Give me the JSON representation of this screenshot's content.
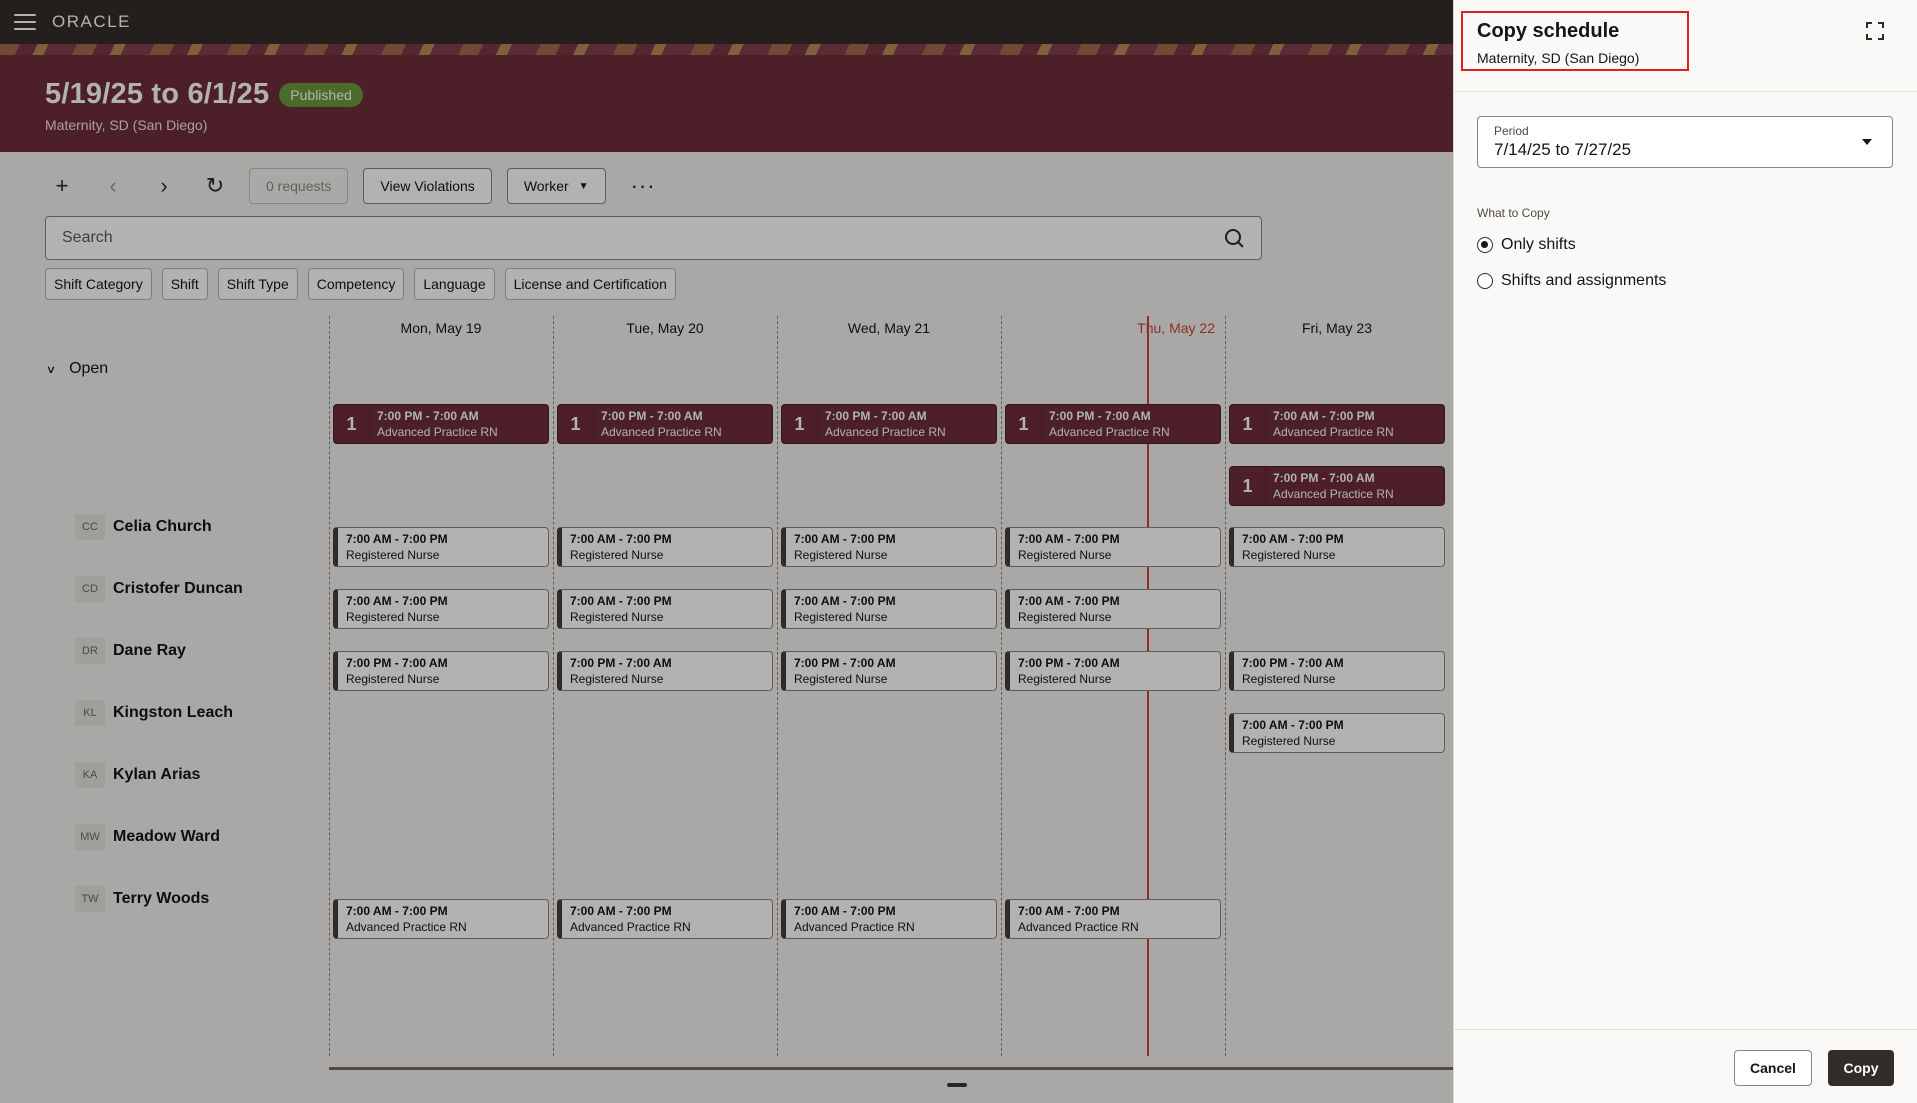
{
  "header": {
    "logo": "ORACLE"
  },
  "schedule": {
    "title": "5/19/25 to 6/1/25",
    "status": "Published",
    "unit": "Maternity, SD (San Diego)"
  },
  "toolbar": {
    "requests_label": "0 requests",
    "view_violations_label": "View Violations",
    "worker_label": "Worker"
  },
  "search": {
    "placeholder": "Search"
  },
  "filters": [
    "Shift Category",
    "Shift",
    "Shift Type",
    "Competency",
    "Language",
    "License and Certification"
  ],
  "days": [
    "Mon, May 19",
    "Tue, May 20",
    "Wed, May 21",
    "Thu, May 22",
    "Fri, May 23"
  ],
  "open_group": {
    "label": "Open"
  },
  "open_shifts": [
    {
      "count": "1",
      "time": "7:00 PM - 7:00 AM",
      "role": "Advanced Practice RN"
    },
    {
      "count": "1",
      "time": "7:00 PM - 7:00 AM",
      "role": "Advanced Practice RN"
    },
    {
      "count": "1",
      "time": "7:00 PM - 7:00 AM",
      "role": "Advanced Practice RN"
    },
    {
      "count": "1",
      "time": "7:00 PM - 7:00 AM",
      "role": "Advanced Practice RN"
    },
    {
      "count": "1",
      "time": "7:00 AM - 7:00 PM",
      "role": "Advanced Practice RN"
    },
    {
      "count": "1",
      "time": "7:00 PM - 7:00 AM",
      "role": "Advanced Practice RN"
    }
  ],
  "workers": [
    {
      "initials": "CC",
      "name": "Celia Church"
    },
    {
      "initials": "CD",
      "name": "Cristofer Duncan"
    },
    {
      "initials": "DR",
      "name": "Dane Ray"
    },
    {
      "initials": "KL",
      "name": "Kingston Leach"
    },
    {
      "initials": "KA",
      "name": "Kylan Arias"
    },
    {
      "initials": "MW",
      "name": "Meadow Ward"
    },
    {
      "initials": "TW",
      "name": "Terry Woods"
    }
  ],
  "shifts": [
    {
      "time": "7:00 AM - 7:00 PM",
      "role": "Registered Nurse"
    },
    {
      "time": "7:00 AM - 7:00 PM",
      "role": "Registered Nurse"
    },
    {
      "time": "7:00 AM - 7:00 PM",
      "role": "Registered Nurse"
    },
    {
      "time": "7:00 AM - 7:00 PM",
      "role": "Registered Nurse"
    },
    {
      "time": "7:00 AM - 7:00 PM",
      "role": "Registered Nurse"
    },
    {
      "time": "7:00 AM - 7:00 PM",
      "role": "Registered Nurse"
    },
    {
      "time": "7:00 AM - 7:00 PM",
      "role": "Registered Nurse"
    },
    {
      "time": "7:00 AM - 7:00 PM",
      "role": "Registered Nurse"
    },
    {
      "time": "7:00 AM - 7:00 PM",
      "role": "Registered Nurse"
    },
    {
      "time": "7:00 PM - 7:00 AM",
      "role": "Registered Nurse"
    },
    {
      "time": "7:00 PM - 7:00 AM",
      "role": "Registered Nurse"
    },
    {
      "time": "7:00 PM - 7:00 AM",
      "role": "Registered Nurse"
    },
    {
      "time": "7:00 PM - 7:00 AM",
      "role": "Registered Nurse"
    },
    {
      "time": "7:00 PM - 7:00 AM",
      "role": "Registered Nurse"
    },
    {
      "time": "7:00 AM - 7:00 PM",
      "role": "Registered Nurse"
    },
    {
      "time": "7:00 AM - 7:00 PM",
      "role": "Advanced Practice RN"
    },
    {
      "time": "7:00 AM - 7:00 PM",
      "role": "Advanced Practice RN"
    },
    {
      "time": "7:00 AM - 7:00 PM",
      "role": "Advanced Practice RN"
    },
    {
      "time": "7:00 AM - 7:00 PM",
      "role": "Advanced Practice RN"
    }
  ],
  "drawer": {
    "title": "Copy schedule",
    "subtitle": "Maternity, SD (San Diego)",
    "period_label": "Period",
    "period_value": "7/14/25 to 7/27/25",
    "what_to_copy_label": "What to Copy",
    "options": [
      "Only shifts",
      "Shifts and assignments"
    ],
    "selected_option": "Only shifts",
    "cancel_label": "Cancel",
    "copy_label": "Copy"
  },
  "colors": {
    "hero": "#6d2d3b",
    "published": "#6a9a3c",
    "today": "#c74634",
    "primary_button": "#312d2a",
    "highlight_border": "#e02020"
  },
  "icons": [
    "menu-icon",
    "plus-icon",
    "chevron-left-icon",
    "chevron-right-icon",
    "refresh-icon",
    "chevron-down-icon",
    "more-icon",
    "search-icon",
    "expand-icon",
    "caret-down-icon"
  ]
}
